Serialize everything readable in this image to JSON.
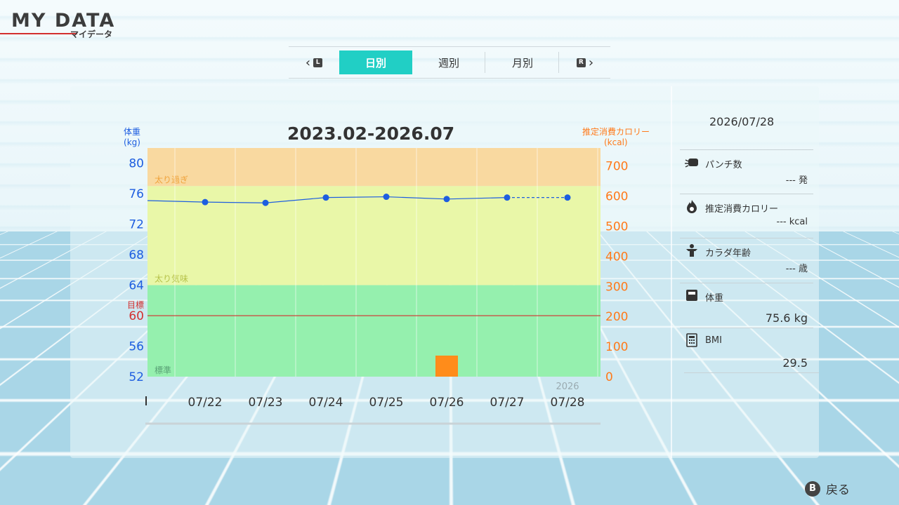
{
  "header": {
    "title": "MY DATA",
    "subtitle": "マイデータ"
  },
  "tabs": {
    "prev_button": "L",
    "next_button": "R",
    "items": [
      {
        "label": "日別",
        "active": true
      },
      {
        "label": "週別",
        "active": false
      },
      {
        "label": "月別",
        "active": false
      }
    ]
  },
  "chart_data": {
    "type": "line",
    "title": "2023.02-2026.07",
    "left_axis_label": "体重",
    "left_axis_unit": "(kg)",
    "right_axis_label": "推定消費カロリー",
    "right_axis_unit": "(kcal)",
    "y_left_ticks": [
      "80",
      "76",
      "72",
      "68",
      "64",
      "60",
      "56",
      "52"
    ],
    "y_left_range": [
      52,
      82
    ],
    "y_right_ticks": [
      "700",
      "600",
      "500",
      "400",
      "300",
      "200",
      "100",
      "0"
    ],
    "y_right_range": [
      0,
      760
    ],
    "target_label": "目標",
    "target_value": 60,
    "bands": [
      {
        "label": "太り過ぎ",
        "from": 77,
        "to": 82,
        "color": "#f9d9a0"
      },
      {
        "label": "太り気味",
        "from": 64,
        "to": 77,
        "color": "#e9f7a8"
      },
      {
        "label": "標準",
        "from": 52,
        "to": 64,
        "color": "#95f0ae"
      }
    ],
    "categories": [
      "07/22",
      "07/23",
      "07/24",
      "07/25",
      "07/26",
      "07/27",
      "07/28"
    ],
    "year_label": "2026",
    "weight_series": {
      "name": "体重",
      "start_value": 75.1,
      "values": [
        74.9,
        74.8,
        75.5,
        75.6,
        75.3,
        75.5,
        75.5
      ],
      "color": "#1e5ee0"
    },
    "calorie_series": {
      "name": "推定消費カロリー",
      "values": [
        0,
        0,
        0,
        0,
        70,
        0,
        0
      ],
      "color": "#ff8c1a"
    },
    "left_tick_color": "#1e5ee0",
    "right_tick_color": "#ff7a1a",
    "target_color": "#d32f2f"
  },
  "side": {
    "date": "2026/07/28",
    "rows": [
      {
        "icon": "punch-icon",
        "label": "パンチ数",
        "value": "---  発"
      },
      {
        "icon": "calorie-flame-icon",
        "label": "推定消費カロリー",
        "value": "--- kcal"
      },
      {
        "icon": "body-age-icon",
        "label": "カラダ年齢",
        "value": "---  歳"
      },
      {
        "icon": "scale-icon",
        "label": "体重",
        "value": "75.6  kg"
      },
      {
        "icon": "calculator-icon",
        "label": "BMI",
        "value": "29.5"
      }
    ]
  },
  "footer": {
    "back_button": "B",
    "back_label": "戻る"
  }
}
